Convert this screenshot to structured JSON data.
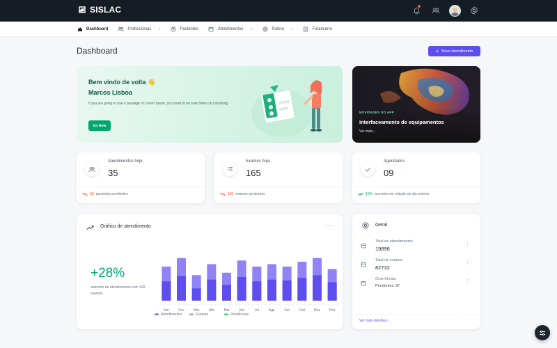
{
  "brand": {
    "name": "SISLAC"
  },
  "nav": {
    "items": [
      {
        "label": "Dashboard",
        "icon": "home-icon",
        "active": true,
        "has_menu": false
      },
      {
        "label": "Profissionais",
        "icon": "users-icon",
        "active": false,
        "has_menu": true
      },
      {
        "label": "Pacientes",
        "icon": "patient-icon",
        "active": false,
        "has_menu": false
      },
      {
        "label": "Atendimentos",
        "icon": "calendar-icon",
        "active": false,
        "has_menu": true
      },
      {
        "label": "Rotina",
        "icon": "target-icon",
        "active": false,
        "has_menu": true
      },
      {
        "label": "Financeiro",
        "icon": "wallet-icon",
        "active": false,
        "has_menu": false
      }
    ]
  },
  "header": {
    "title": "Dashboard",
    "new_button": "Novo Atendimento"
  },
  "welcome": {
    "greeting": "Bem vindo de volta 👋",
    "name": "Marcos Lisboa",
    "description": "If you are going to use a passage of Lorem Ipsum, you need to be sure there isn't anything",
    "button": "Go Now"
  },
  "promo": {
    "tag": "NOVIDADES DO APP",
    "title": "Interfaceamento de equipamentos",
    "link": "Ver mais..."
  },
  "stats": [
    {
      "label": "Atendimentos hoje",
      "value": "35",
      "trend_value": "25",
      "trend_text": "pacientes pendentes",
      "trend": "down",
      "icon": "users-icon"
    },
    {
      "label": "Exames hoje",
      "value": "165",
      "trend_value": "120",
      "trend_text": "exames pendentes",
      "trend": "down",
      "icon": "list-icon"
    },
    {
      "label": "Agendados",
      "value": "09",
      "trend_value": "15%",
      "trend_text": "aumento em relação do dia anterior",
      "trend": "up",
      "icon": "check-icon"
    }
  ],
  "chart_card": {
    "title": "Gráfico de atendimento",
    "big_value": "+28%",
    "subtitle": "aumento de atendimentos com 118 exames"
  },
  "chart_data": {
    "type": "bar",
    "categories": [
      "Jan",
      "Fev",
      "Mar",
      "Abr",
      "Mai",
      "Jun",
      "Jul",
      "Ago",
      "Set",
      "Out",
      "Nov",
      "Dez"
    ],
    "series": [
      {
        "name": "Atendimentos",
        "values": [
          22,
          28,
          14,
          24,
          18,
          27,
          22,
          24,
          23,
          26,
          29,
          21
        ],
        "color": "#5e4ef0"
      },
      {
        "name": "Exames",
        "values": [
          28,
          35,
          21,
          30,
          23,
          33,
          28,
          30,
          28,
          32,
          35,
          26
        ],
        "color": "#8f83f6"
      },
      {
        "name": "Pendências",
        "values": [
          0,
          0,
          0,
          0,
          0,
          0,
          0,
          0,
          0,
          0,
          0,
          0
        ],
        "color": "#22c55e"
      }
    ],
    "ylim": [
      0,
      40
    ],
    "grid": false,
    "legend": "bottom"
  },
  "geral": {
    "title": "Geral",
    "rows": [
      {
        "label": "Total de atendimentos",
        "value": "19896"
      },
      {
        "label": "Total de exames",
        "value": "82732"
      },
      {
        "label": "Ocorrências",
        "value": "Pendentes: 87"
      }
    ],
    "link": "Ver mais detalhes"
  },
  "colors": {
    "primary": "#5e4ef0",
    "success": "#00a76f",
    "error": "#ff5630",
    "topbar": "#161c24"
  }
}
